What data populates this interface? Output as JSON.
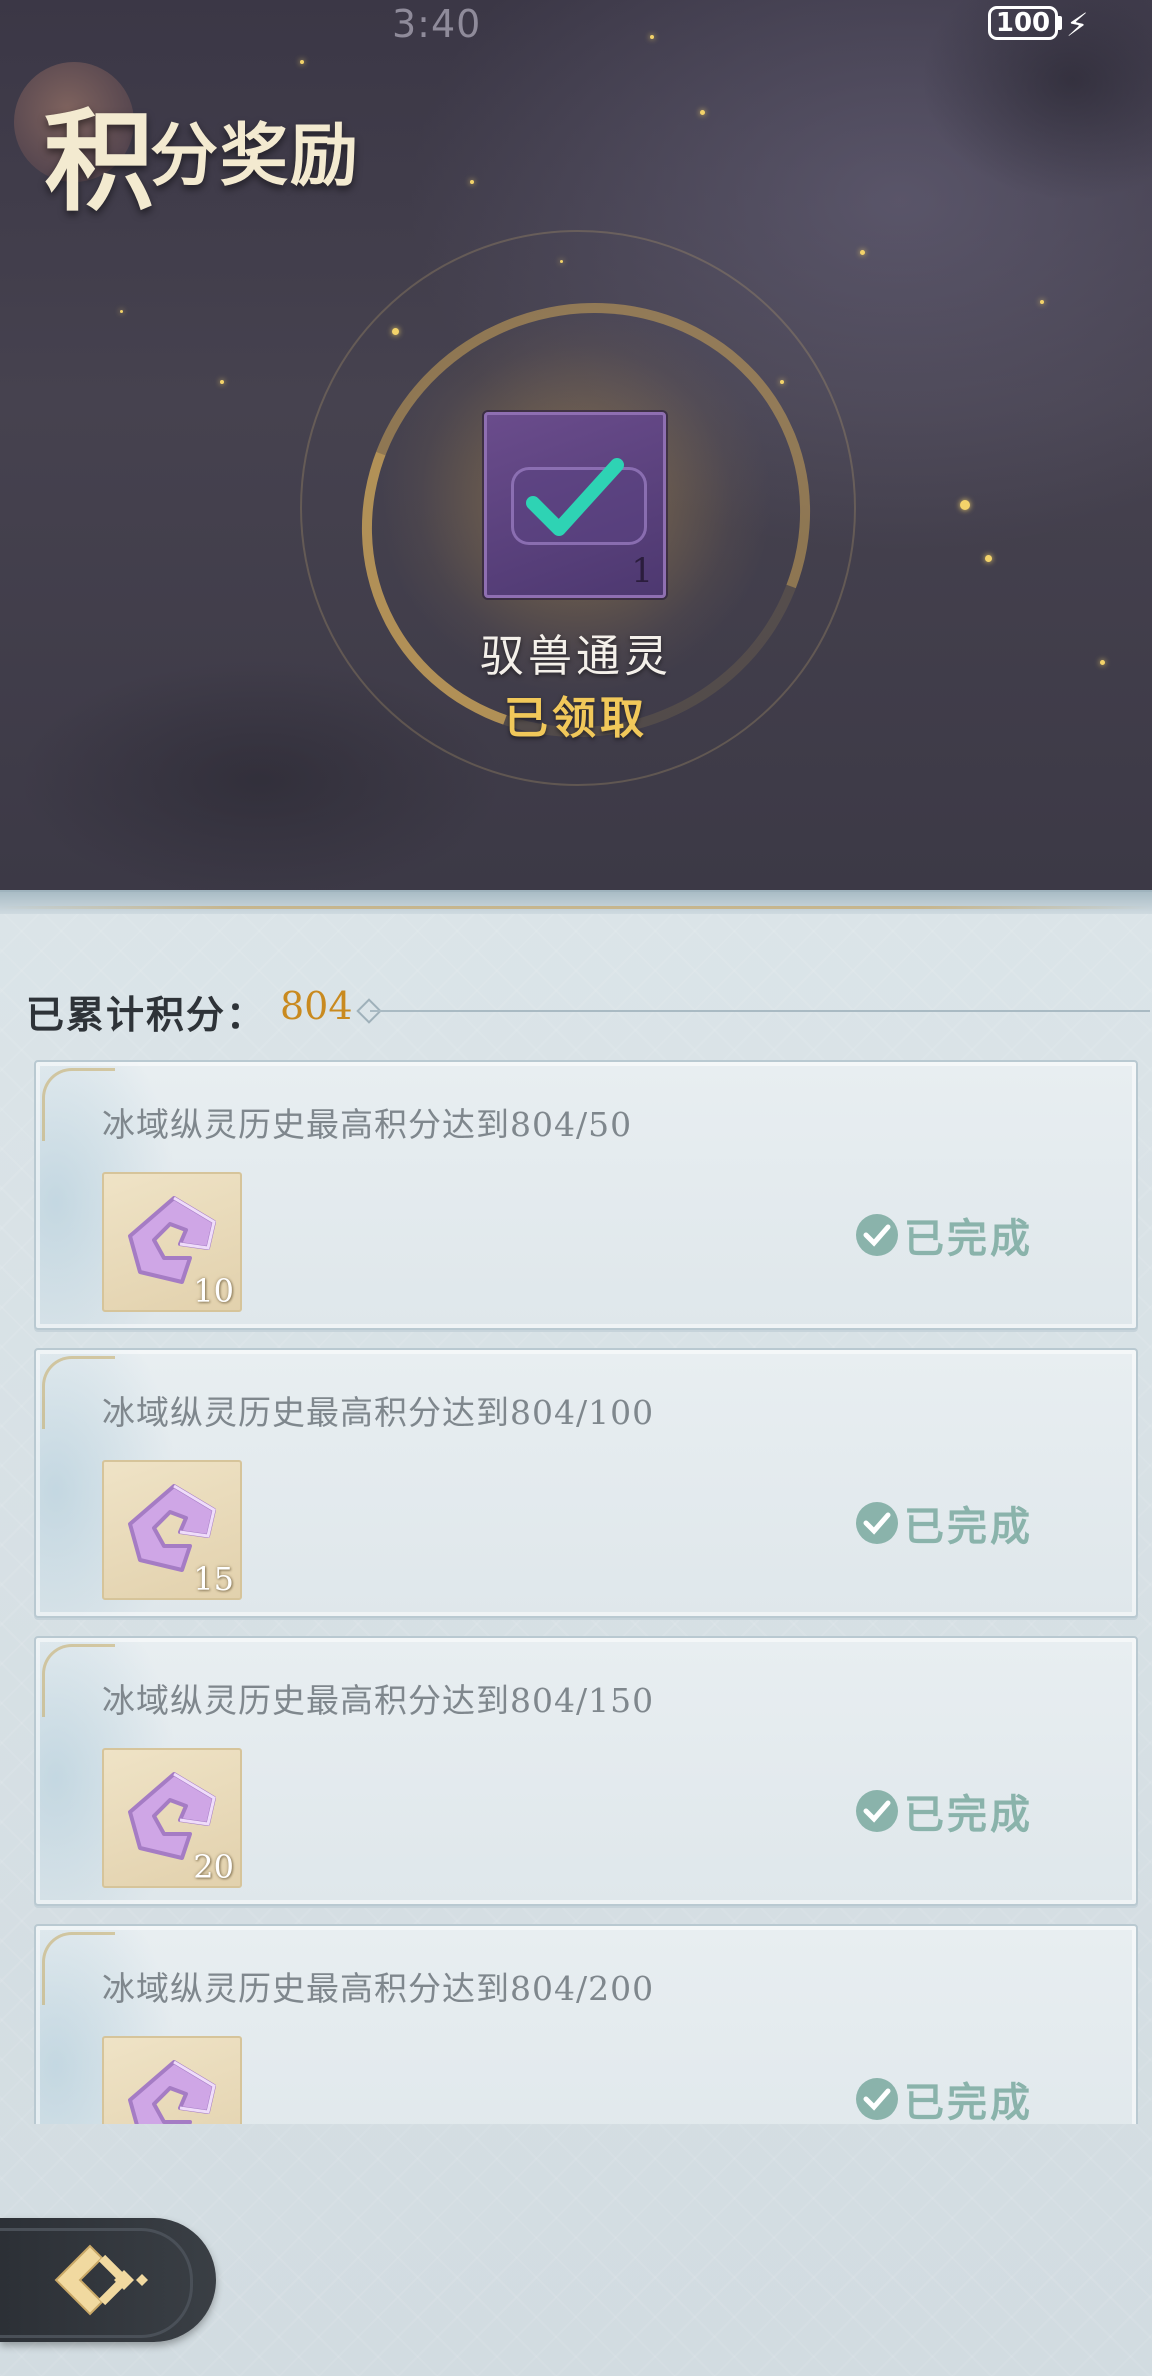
{
  "status_bar": {
    "time": "3:40",
    "battery": "100"
  },
  "header": {
    "title_first": "积",
    "title_rest": "分奖励"
  },
  "featured_reward": {
    "count": "1",
    "name": "驭兽通灵",
    "status": "已领取"
  },
  "summary": {
    "label": "已累计积分：",
    "value": "804"
  },
  "tasks": [
    {
      "title": "冰域纵灵历史最高积分达到804/50",
      "qty": "10",
      "status": "已完成"
    },
    {
      "title": "冰域纵灵历史最高积分达到804/100",
      "qty": "15",
      "status": "已完成"
    },
    {
      "title": "冰域纵灵历史最高积分达到804/150",
      "qty": "20",
      "status": "已完成"
    },
    {
      "title": "冰域纵灵历史最高积分达到804/200",
      "qty": "",
      "status": "已完成"
    }
  ],
  "colors": {
    "accent_gold": "#f1c85a",
    "done_green": "#8ab3ab",
    "score_orange": "#c98a1f"
  },
  "icons": {
    "back": "back-arrow-icon",
    "done": "check-circle-icon",
    "reward": "purple-gem-icon"
  }
}
